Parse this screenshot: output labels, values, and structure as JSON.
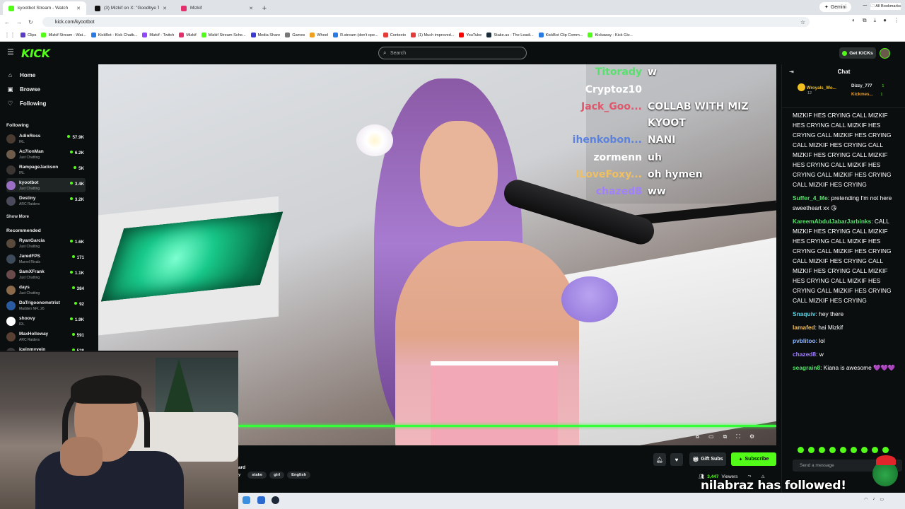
{
  "browser": {
    "tabs": [
      {
        "label": "kyootbot Stream - Watch",
        "fav": "#53fc18"
      },
      {
        "label": "(3) Mizkif on X: \"Goodbye Twit...",
        "fav": "#111111"
      },
      {
        "label": "Mizkif",
        "fav": "#e1306c"
      }
    ],
    "gemini_label": "Gemini",
    "url": "kick.com/kyootbot",
    "bookmarks": [
      {
        "label": "Clips",
        "color": "#5b3cc4"
      },
      {
        "label": "Mizkif Stream - Wat...",
        "color": "#53fc18"
      },
      {
        "label": "KickBot - Kick Chatb...",
        "color": "#2a7ae4"
      },
      {
        "label": "Mizkif - Twitch",
        "color": "#9146ff"
      },
      {
        "label": "Mizkif",
        "color": "#e1306c"
      },
      {
        "label": "Mizkif Stream Sche...",
        "color": "#53fc18"
      },
      {
        "label": "Media Share",
        "color": "#3b3bd4"
      },
      {
        "label": "Games",
        "color": "#777777"
      },
      {
        "label": "Wheel",
        "color": "#f0a020"
      },
      {
        "label": "R.stream (don't ope...",
        "color": "#2a7ae4"
      },
      {
        "label": "Contexto",
        "color": "#e43b3b"
      },
      {
        "label": "(1) Much improved...",
        "color": "#e43b3b"
      },
      {
        "label": "YouTube",
        "color": "#ff0000"
      },
      {
        "label": "Stake.us - The Leadi...",
        "color": "#1a2c38"
      },
      {
        "label": "KickBot Clip Comm...",
        "color": "#2a7ae4"
      },
      {
        "label": "Kickaway - Kick Giv...",
        "color": "#53fc18"
      }
    ],
    "all_bookmarks": "All Bookmarks"
  },
  "header": {
    "logo": "KICK",
    "search_placeholder": "Search",
    "get_kicks": "Get KICKs"
  },
  "sidebar": {
    "nav": [
      {
        "label": "Home",
        "icon": "⌂"
      },
      {
        "label": "Browse",
        "icon": "▣"
      },
      {
        "label": "Following",
        "icon": "♡"
      }
    ],
    "following_title": "Following",
    "following": [
      {
        "name": "AdinRoss",
        "cat": "IRL",
        "viewers": "57.9K",
        "color": "#4a3b32"
      },
      {
        "name": "Ac7ionMan",
        "cat": "Just Chatting",
        "viewers": "6.2K",
        "color": "#6f5c4a"
      },
      {
        "name": "RampageJackson",
        "cat": "IRL",
        "viewers": "5K",
        "color": "#3a3432"
      },
      {
        "name": "kyootbot",
        "cat": "Just Chatting",
        "viewers": "3.4K",
        "color": "#9a6fc4"
      },
      {
        "name": "Destiny",
        "cat": "ARC Raiders",
        "viewers": "3.2K",
        "color": "#4a4a5a"
      }
    ],
    "show_more": "Show More",
    "recommended_title": "Recommended",
    "recommended": [
      {
        "name": "RyanGarcia",
        "cat": "Just Chatting",
        "viewers": "1.6K",
        "color": "#5a4a3c"
      },
      {
        "name": "JaredFPS",
        "cat": "Marvel Rivals",
        "viewers": "171",
        "color": "#3c4a5a"
      },
      {
        "name": "SamXFrank",
        "cat": "Just Chatting",
        "viewers": "1.1K",
        "color": "#6a4a4a"
      },
      {
        "name": "days",
        "cat": "Just Chatting",
        "viewers": "384",
        "color": "#8a6a4a"
      },
      {
        "name": "DaTrigoonometrist",
        "cat": "Madden NFL 26",
        "viewers": "92",
        "color": "#2a5aa0"
      },
      {
        "name": "shoovy",
        "cat": "IRL",
        "viewers": "1.9K",
        "color": "#ffffff"
      },
      {
        "name": "MaxHolloway",
        "cat": "ARC Raiders",
        "viewers": "591",
        "color": "#5a4032"
      },
      {
        "name": "iceinmyvein",
        "cat": "",
        "viewers": "528",
        "color": "#3a3a3a"
      }
    ]
  },
  "video_chat_overlay": [
    {
      "user": "Titorady",
      "msg": "w",
      "color": "#58e06c"
    },
    {
      "user": "Cryptoz10",
      "msg": "",
      "color": "#ffffff"
    },
    {
      "user": "Jack_Goo...",
      "msg": "COLLAB WITH MIZ",
      "color": "#e0566a"
    },
    {
      "user": "",
      "msg": "KYOOT",
      "color": "#ffffff"
    },
    {
      "user": "ihenkobon...",
      "msg": "NANI",
      "color": "#5a82e0"
    },
    {
      "user": "zormenn",
      "msg": "uh",
      "color": "#ffffff"
    },
    {
      "user": "ILoveFoxy...",
      "msg": "oh hymen",
      "color": "#f0c060"
    },
    {
      "user": "chazed8",
      "msg": "ww",
      "color": "#a080ff"
    }
  ],
  "stream": {
    "streamer_name_fragment": "ard",
    "tags": [
      "stake",
      "girl",
      "English"
    ],
    "gift_subs": "Gift Subs",
    "subscribe": "Subscribe",
    "viewers": "3,447",
    "viewers_label": "Viewers"
  },
  "chat": {
    "title": "Chat",
    "pinned_gifters": [
      {
        "name": "Wroyals_Wo...",
        "count": "12",
        "color": "#f0c020"
      },
      {
        "name": "Dizzy_777",
        "count": "1",
        "color": "#ffffff"
      },
      {
        "name": "Kickmes...",
        "count": "1",
        "color": "#f0a020"
      }
    ],
    "messages": [
      {
        "user": "",
        "text": "MIZKIF HES CRYING CALL MIZKIF HES CRYING CALL MIZKIF HES CRYING CALL MIZKIF HES CRYING CALL MIZKIF HES CRYING CALL MIZKIF HES CRYING CALL MIZKIF HES CRYING CALL MIZKIF HES CRYING CALL MIZKIF HES CRYING CALL MIZKIF HES CRYING",
        "color": "#ffffff"
      },
      {
        "user": "Suffer_4_Me",
        "text": "pretending I'm not here sweetheart xx 😘",
        "color": "#58e06c"
      },
      {
        "user": "KareemAbdulJabarJarbinks",
        "text": "CALL MIZKIF HES CRYING CALL MIZKIF HES CRYING CALL MIZKIF HES CRYING CALL MIZKIF HES CRYING CALL MIZKIF HES CRYING CALL MIZKIF HES CRYING CALL MIZKIF HES CRYING CALL MIZKIF HES CRYING CALL MIZKIF HES CRYING CALL MIZKIF HES CRYING",
        "color": "#58e06c"
      },
      {
        "user": "Snaquiv",
        "text": "hey there",
        "color": "#5ad0e0"
      },
      {
        "user": "lamafed",
        "text": "hai Mizkif",
        "color": "#f0c060"
      },
      {
        "user": "pvblitoo",
        "text": "lol",
        "color": "#8ab4ff"
      },
      {
        "user": "chazed8",
        "text": "w",
        "color": "#a080ff"
      },
      {
        "user": "seagrain8",
        "text": "Kiana is awesome 💜💜💜",
        "color": "#58e06c"
      }
    ],
    "send_placeholder": "Send a message"
  },
  "overlay_follow_alert": "nilabraz has followed!"
}
